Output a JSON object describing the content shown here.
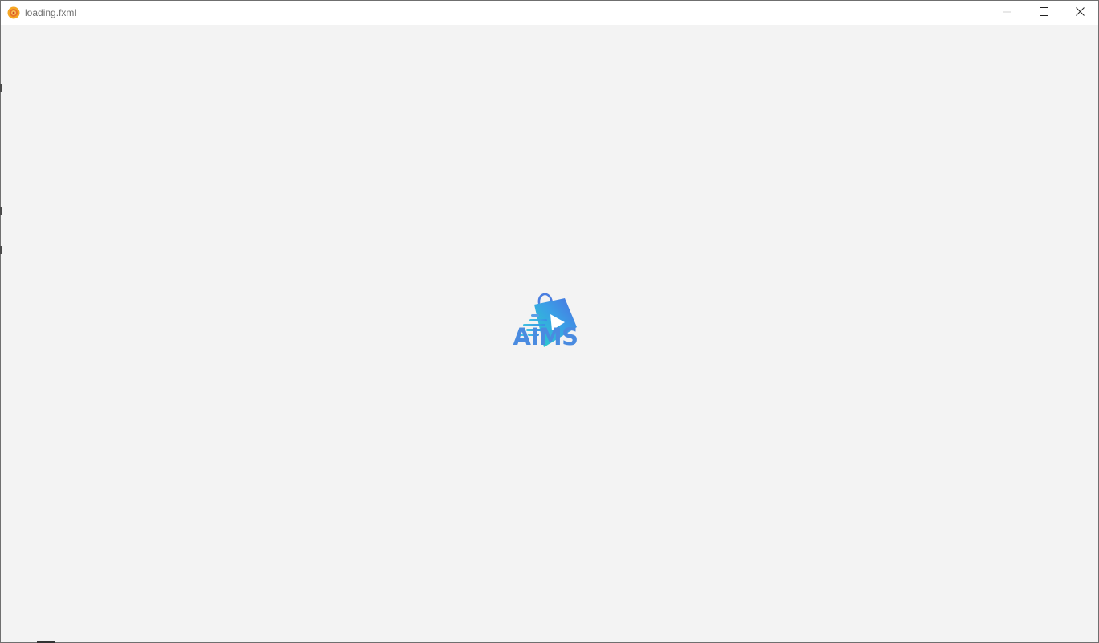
{
  "window": {
    "title": "loading.fxml",
    "app_icon": "java-app-icon",
    "controls": {
      "minimize": "minimize-icon",
      "maximize": "maximize-icon",
      "close": "close-icon"
    }
  },
  "splash": {
    "logo_icon": "shopping-bag-play-icon",
    "app_name": "AIMS",
    "brand_color": "#4a8be0"
  }
}
